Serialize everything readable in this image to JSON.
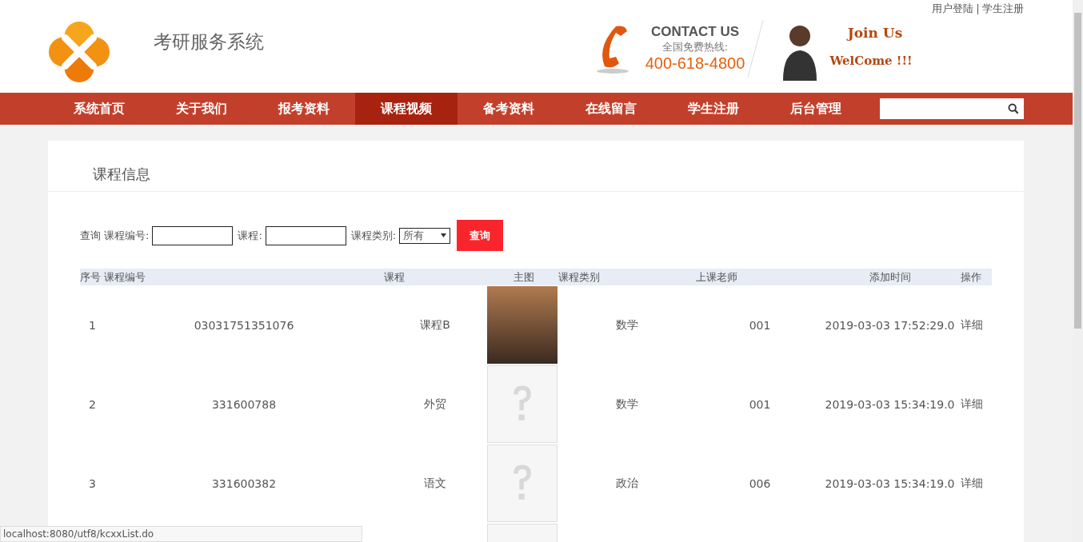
{
  "top_links": [
    "用户登陆",
    "学生注册"
  ],
  "site_title": "考研服务系统",
  "contact": {
    "heading": "CONTACT US",
    "hotline_label": "全国免费热线:",
    "phone": "400-618-4800"
  },
  "banner": {
    "line_1": "Join Us",
    "line_2": "WelCome !!!"
  },
  "nav": [
    {
      "label": "系统首页",
      "selected": false
    },
    {
      "label": "关于我们",
      "selected": false
    },
    {
      "label": "报考资料",
      "selected": false
    },
    {
      "label": "课程视频",
      "selected": true
    },
    {
      "label": "备考资料",
      "selected": false
    },
    {
      "label": "在线留言",
      "selected": false
    },
    {
      "label": "学生注册",
      "selected": false
    },
    {
      "label": "后台管理",
      "selected": false
    }
  ],
  "panel_title": "课程信息",
  "filter": {
    "label": "查询",
    "fields": [
      {
        "label": "课程编号:"
      },
      {
        "label": "课程:"
      }
    ],
    "category_label": "课程类别:",
    "category_value": "所有",
    "button": "查询"
  },
  "table": {
    "columns": [
      "序号",
      "课程编号",
      "课程",
      "主图",
      "课程类别",
      "上课老师",
      "添加时间",
      "操作"
    ],
    "rows": [
      {
        "index": "1",
        "code": "03031751351076",
        "course": "课程B",
        "kind": "photo",
        "category": "数学",
        "teacher": "001",
        "added": "2019-03-03 17:52:29.0",
        "action": "详细"
      },
      {
        "index": "2",
        "code": "331600788",
        "course": "外贸",
        "kind": "placeholder",
        "category": "数学",
        "teacher": "001",
        "added": "2019-03-03 15:34:19.0",
        "action": "详细"
      },
      {
        "index": "3",
        "code": "331600382",
        "course": "语文",
        "kind": "placeholder",
        "category": "政治",
        "teacher": "006",
        "added": "2019-03-03 15:34:19.0",
        "action": "详细"
      },
      {
        "kind": "placeholder"
      }
    ]
  },
  "status_bar": "localhost:8080/utf8/kcxxList.do"
}
